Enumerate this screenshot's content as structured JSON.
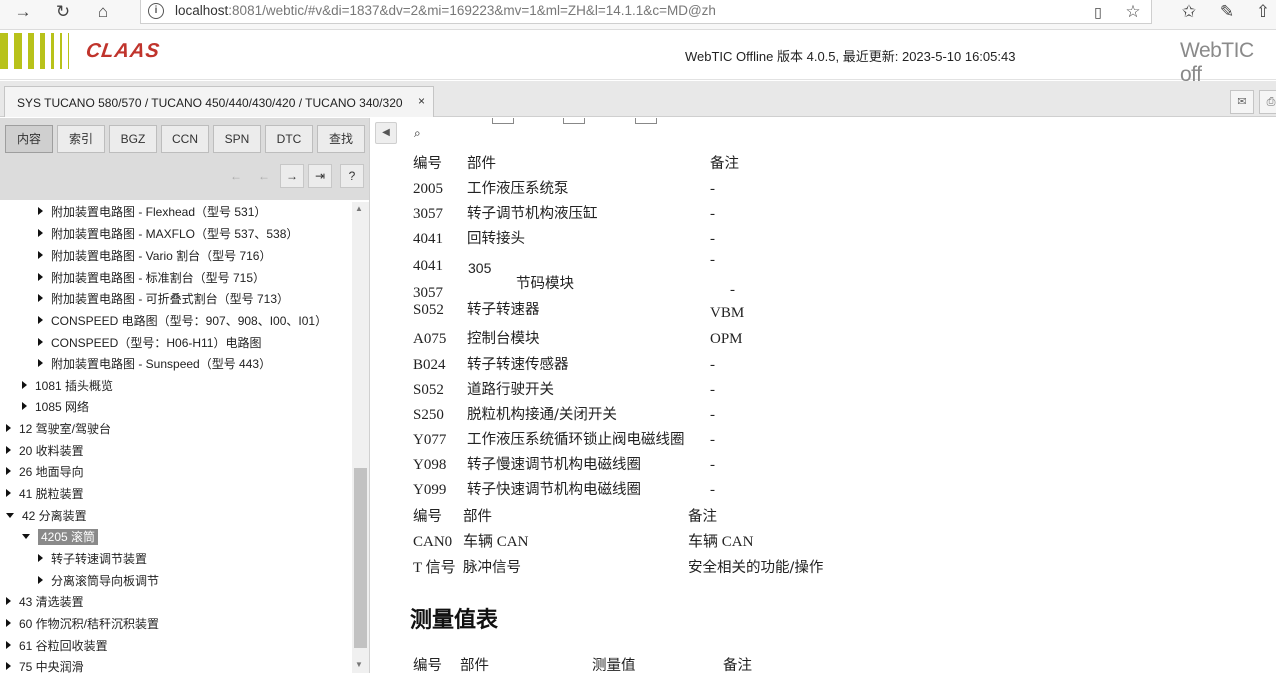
{
  "browser": {
    "url_host": "localhost",
    "url_rest": ":8081/webtic/#v&di=1837&dv=2&mi=169223&mv=1&ml=ZH&l=14.1.1&c=MD@zh"
  },
  "header": {
    "logo": "CLAAS",
    "version": "WebTIC Offline 版本 4.0.5, 最近更新:  2023-5-10 16:05:43",
    "brand": "WebTIC off",
    "colors": {
      "logo_green": "#b8c21a",
      "logo_red": "#c0342c"
    }
  },
  "doc_tab": {
    "label": "SYS TUCANO 580/570 / TUCANO 450/440/430/420 / TUCANO 340/320",
    "close": "×"
  },
  "nav_tabs": [
    "内容",
    "索引",
    "BGZ",
    "CCN",
    "SPN",
    "DTC",
    "查找"
  ],
  "nav_buttons": [
    "←",
    "←",
    "→",
    "⇥",
    "?"
  ],
  "tree": [
    {
      "label": "附加装置电路图 - Flexhead（型号 531）",
      "level": 2
    },
    {
      "label": "附加装置电路图 - MAXFLO（型号 537、538）",
      "level": 2
    },
    {
      "label": "附加装置电路图 - Vario 割台（型号 716）",
      "level": 2
    },
    {
      "label": "附加装置电路图 - 标准割台（型号 715）",
      "level": 2
    },
    {
      "label": "附加装置电路图 - 可折叠式割台（型号 713）",
      "level": 2
    },
    {
      "label": "CONSPEED 电路图（型号：907、908、I00、I01）",
      "level": 2
    },
    {
      "label": "CONSPEED（型号：H06-H11）电路图",
      "level": 2
    },
    {
      "label": "附加装置电路图 - Sunspeed（型号 443）",
      "level": 2
    },
    {
      "label": "1081 插头概览",
      "level": 1
    },
    {
      "label": "1085 网络",
      "level": 1
    },
    {
      "label": "12 驾驶室/驾驶台",
      "level": 0
    },
    {
      "label": "20 收料装置",
      "level": 0
    },
    {
      "label": "26 地面导向",
      "level": 0
    },
    {
      "label": "41 脱粒装置",
      "level": 0
    },
    {
      "label": "42 分离装置",
      "level": 0,
      "open": true
    },
    {
      "label": "4205 滚筒",
      "level": 1,
      "open": true,
      "selected": true
    },
    {
      "label": "转子转速调节装置",
      "level": 2
    },
    {
      "label": "分离滚筒导向板调节",
      "level": 2
    },
    {
      "label": "43 清选装置",
      "level": 0
    },
    {
      "label": "60 作物沉积/秸秆沉积装置",
      "level": 0
    },
    {
      "label": "61 谷粒回收装置",
      "level": 0
    },
    {
      "label": "75 中央润滑",
      "level": 0
    }
  ],
  "table1": {
    "headers": [
      "编号",
      "部件",
      "备注"
    ],
    "rows": [
      [
        "2005",
        "工作液压系统泵",
        "-"
      ],
      [
        "3057",
        "转子调节机构液压缸",
        "-"
      ],
      [
        "4041",
        "回转接头",
        "-"
      ],
      [
        "4041",
        "",
        "-"
      ],
      [
        "3057",
        "节码模块",
        "-"
      ],
      [
        "S052",
        "转子转速器",
        "VBM"
      ],
      [
        "A075",
        "控制台模块",
        "OPM"
      ],
      [
        "B024",
        "转子转速传感器",
        "-"
      ],
      [
        "S052",
        "道路行驶开关",
        "-"
      ],
      [
        "S250",
        "脱粒机构接通/关闭开关",
        "-"
      ],
      [
        "Y077",
        "工作液压系统循环锁止阀电磁线圈",
        "-"
      ],
      [
        "Y098",
        "转子慢速调节机构电磁线圈",
        "-"
      ],
      [
        "Y099",
        "转子快速调节机构电磁线圈",
        "-"
      ]
    ],
    "artifact": "305"
  },
  "table2": {
    "headers": [
      "编号",
      "部件",
      "备注"
    ],
    "rows": [
      [
        "CAN0",
        "车辆 CAN",
        "车辆 CAN"
      ],
      [
        "T 信号",
        "脉冲信号",
        "安全相关的功能/操作"
      ]
    ]
  },
  "measure": {
    "title": "测量值表",
    "headers": [
      "编号",
      "部件",
      "测量值",
      "备注"
    ]
  }
}
